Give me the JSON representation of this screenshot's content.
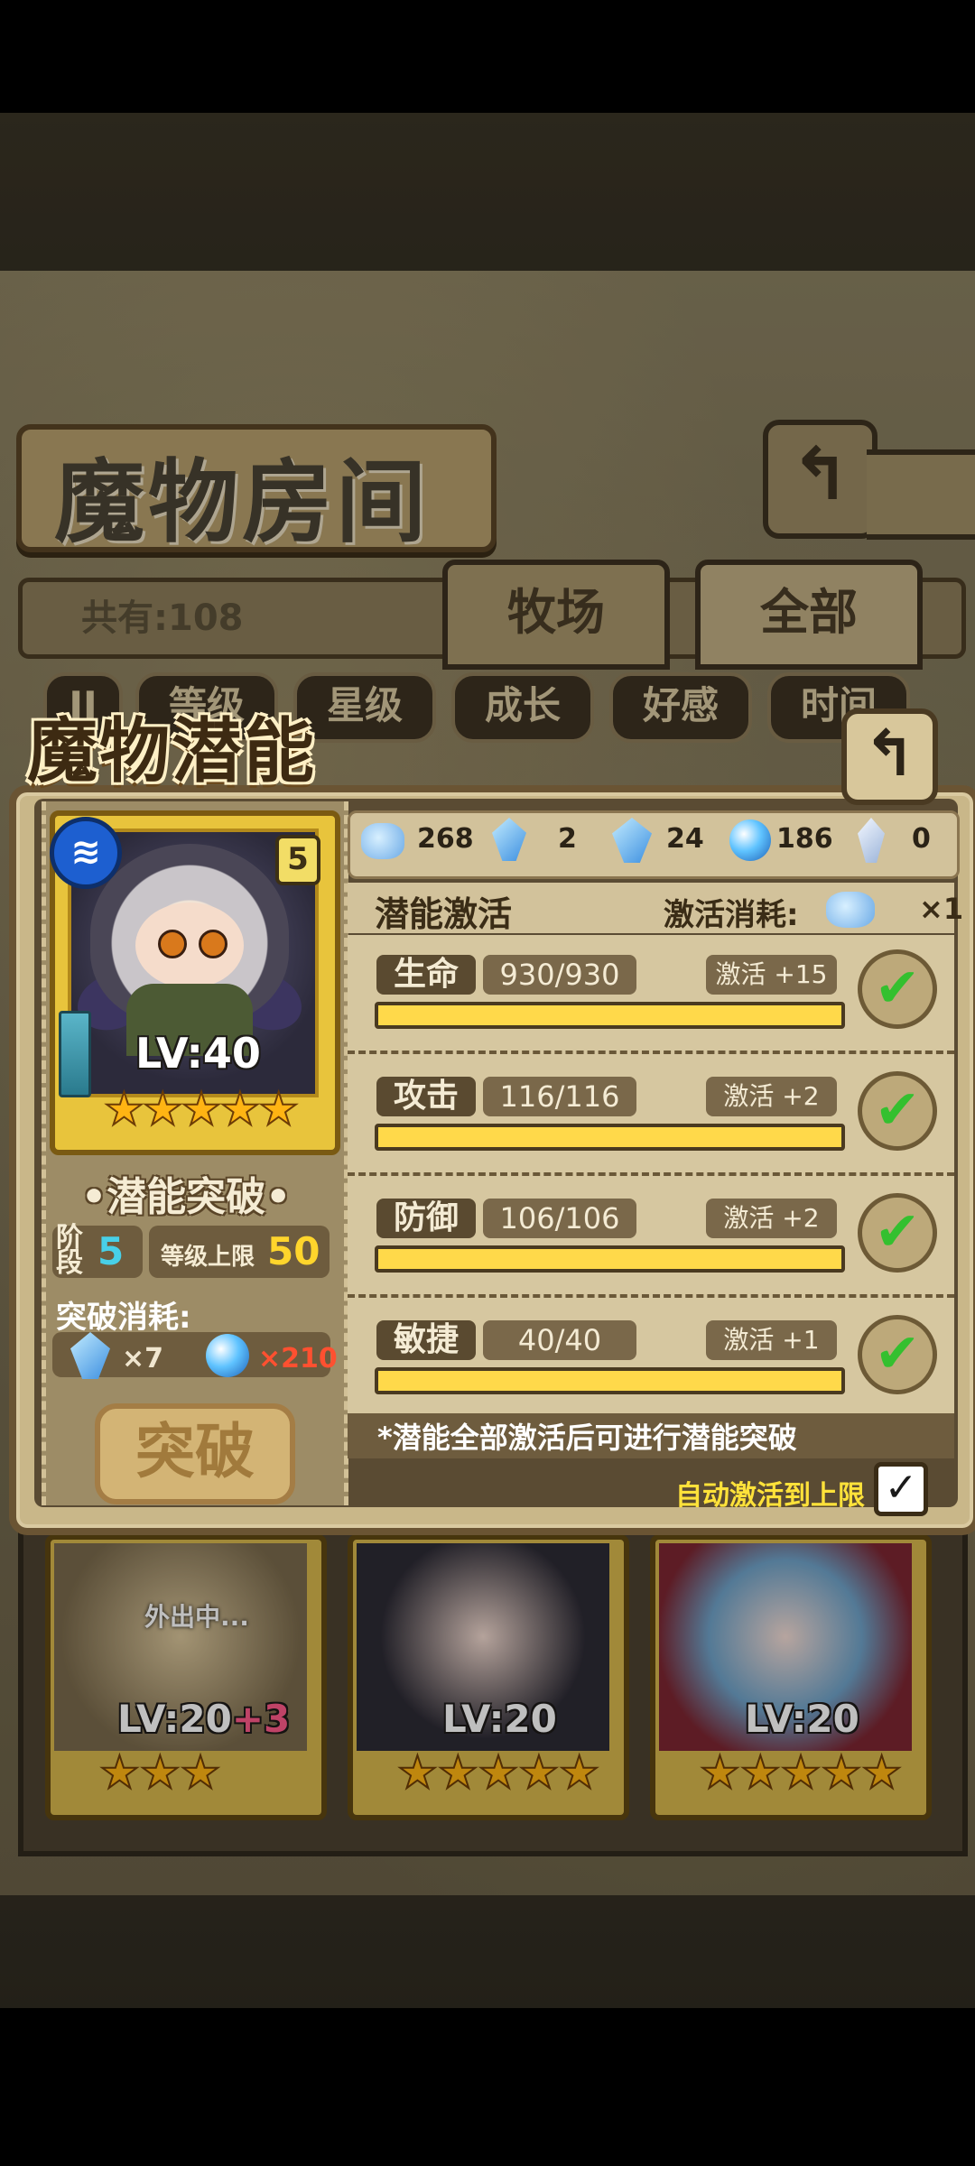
{
  "screen": {
    "room_title": "魔物房间",
    "total_label": "共有:108",
    "tabs": [
      "牧场",
      "全部"
    ],
    "filters": [
      "II",
      "等级",
      "星级",
      "成长",
      "好感",
      "时间"
    ]
  },
  "dialog": {
    "title": "魔物潜能",
    "monster": {
      "level": "LV:40",
      "rank": "5",
      "stars": "★★★★★",
      "element_icon": "water-wave-icon"
    },
    "breakthrough": {
      "title": "•潜能突破•",
      "stage_label": "阶段",
      "stage_value": "5",
      "cap_label": "等级上限",
      "cap_value": "50",
      "cost_title": "突破消耗:",
      "cost_crystal": "×7",
      "cost_orb": "×210",
      "button": "突破"
    },
    "resources": [
      {
        "icon": "ore-icon",
        "value": "268"
      },
      {
        "icon": "crystal-small-icon",
        "value": "2"
      },
      {
        "icon": "crystal-large-icon",
        "value": "24"
      },
      {
        "icon": "orb-icon",
        "value": "186"
      },
      {
        "icon": "shard-icon",
        "value": "0"
      }
    ],
    "potential": {
      "title": "潜能激活",
      "cost_label": "激活消耗:",
      "cost_value": "×1",
      "stats": [
        {
          "name": "生命",
          "value": "930/930",
          "bonus": "激活 +15",
          "progress": 1.0
        },
        {
          "name": "攻击",
          "value": "116/116",
          "bonus": "激活 +2",
          "progress": 1.0
        },
        {
          "name": "防御",
          "value": "106/106",
          "bonus": "激活 +2",
          "progress": 1.0
        },
        {
          "name": "敏捷",
          "value": "40/40",
          "bonus": "激活 +1",
          "progress": 1.0
        }
      ],
      "note": "*潜能全部激活后可进行潜能突破",
      "auto_label": "自动激活到上限",
      "auto_checked": true
    }
  },
  "list": {
    "cards": [
      {
        "level": "LV:20",
        "bonus": "+3",
        "stars": "★★★",
        "status": "外出中..."
      },
      {
        "level": "LV:20",
        "bonus": "",
        "stars": "★★★★★",
        "status": ""
      },
      {
        "level": "LV:20",
        "bonus": "",
        "stars": "★★★★★",
        "status": ""
      }
    ]
  },
  "colors": {
    "accent_gold": "#ffd94a",
    "check_green": "#34c02f",
    "cost_red": "#ff5030",
    "stage_cyan": "#48d0e8"
  }
}
